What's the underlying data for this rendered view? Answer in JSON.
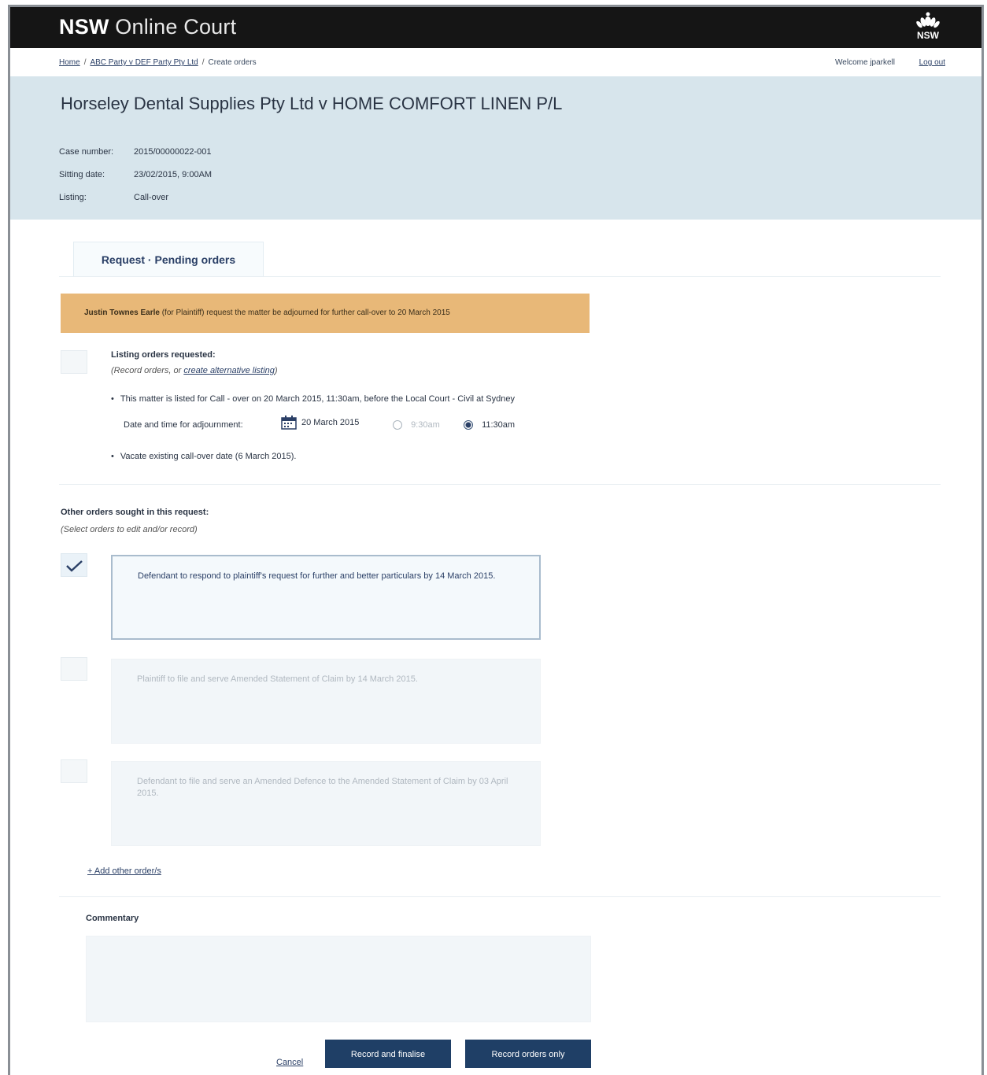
{
  "app": {
    "brand_bold": "NSW",
    "brand_light": "Online Court",
    "logo_text": "NSW"
  },
  "breadcrumb": {
    "home": "Home",
    "case": "ABC Party v DEF Party Pty Ltd",
    "current": "Create orders",
    "sep": "/"
  },
  "user": {
    "welcome": "Welcome jparkell",
    "logout": "Log out"
  },
  "case": {
    "title": "Horseley Dental Supplies Pty Ltd v HOME COMFORT LINEN P/L",
    "meta": [
      {
        "key": "Case number:",
        "value": "2015/00000022-001"
      },
      {
        "key": "Sitting date:",
        "value": "23/02/2015, 9:00AM"
      },
      {
        "key": "Listing:",
        "value": "Call-over"
      }
    ]
  },
  "tabs": [
    {
      "label": "Request · Pending orders"
    }
  ],
  "notice": {
    "name": "Justin Townes Earle",
    "text": " (for Plaintiff) request the matter be adjourned  for further call-over to 20 March 2015"
  },
  "listing": {
    "heading": "Listing orders requested:",
    "sub_prefix": "(Record orders, or ",
    "sub_link": "create alternative listing",
    "sub_suffix": ")",
    "bullet1": "This matter is listed for Call - over on 20 March 2015, 11:30am, before the Local Court -  Civil at Sydney",
    "date_label": "Date and time for adjournment:",
    "date_value": "20 March 2015",
    "time_options": [
      {
        "label": "9:30am",
        "selected": false
      },
      {
        "label": "11:30am",
        "selected": true
      }
    ],
    "bullet2": "Vacate existing call-over date (6 March 2015)."
  },
  "other": {
    "heading": "Other orders sought in this request:",
    "sub": "(Select orders to edit and/or record)",
    "orders": [
      {
        "text": "Defendant to respond to plaintiff's request for further and better particulars by 14 March 2015.",
        "checked": true
      },
      {
        "text": "Plaintiff to file and serve Amended Statement of Claim by 14 March 2015.",
        "checked": false
      },
      {
        "text": "Defendant to file and serve an Amended Defence to the Amended Statement of Claim by 03 April 2015.",
        "checked": false
      }
    ],
    "add_link": "+ Add other order/s"
  },
  "commentary": {
    "label": "Commentary",
    "value": ""
  },
  "actions": {
    "cancel": "Cancel",
    "record_finalise": "Record and finalise",
    "record_only": "Record orders only"
  },
  "colors": {
    "topbar": "#151515",
    "case_header": "#d7e5ec",
    "notice": "#e8b878",
    "primary_button": "#1f3f66"
  }
}
